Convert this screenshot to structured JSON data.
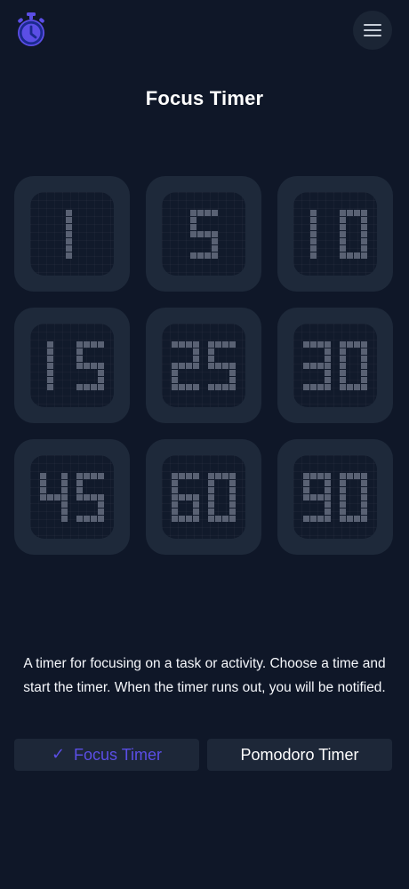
{
  "app": {
    "title": "Focus Timer",
    "logo_icon": "stopwatch-icon",
    "menu_icon": "hamburger-menu-icon"
  },
  "theme": {
    "background": "#0f1728",
    "card": "#1e293a",
    "face": "#111a2b",
    "digit": "#596173",
    "accent": "#5b4ee6",
    "text": "#ffffff"
  },
  "timers": [
    {
      "label": "1"
    },
    {
      "label": "5"
    },
    {
      "label": "10"
    },
    {
      "label": "15"
    },
    {
      "label": "25"
    },
    {
      "label": "30"
    },
    {
      "label": "45"
    },
    {
      "label": "60"
    },
    {
      "label": "90"
    }
  ],
  "description": "A timer for focusing on a task or activity. Choose a time and start the timer. When the timer runs out, you will be notified.",
  "modes": {
    "focus": {
      "label": "Focus Timer",
      "check": "✓",
      "icon": "check-icon",
      "active": true
    },
    "pomodoro": {
      "label": "Pomodoro Timer",
      "active": false
    }
  }
}
